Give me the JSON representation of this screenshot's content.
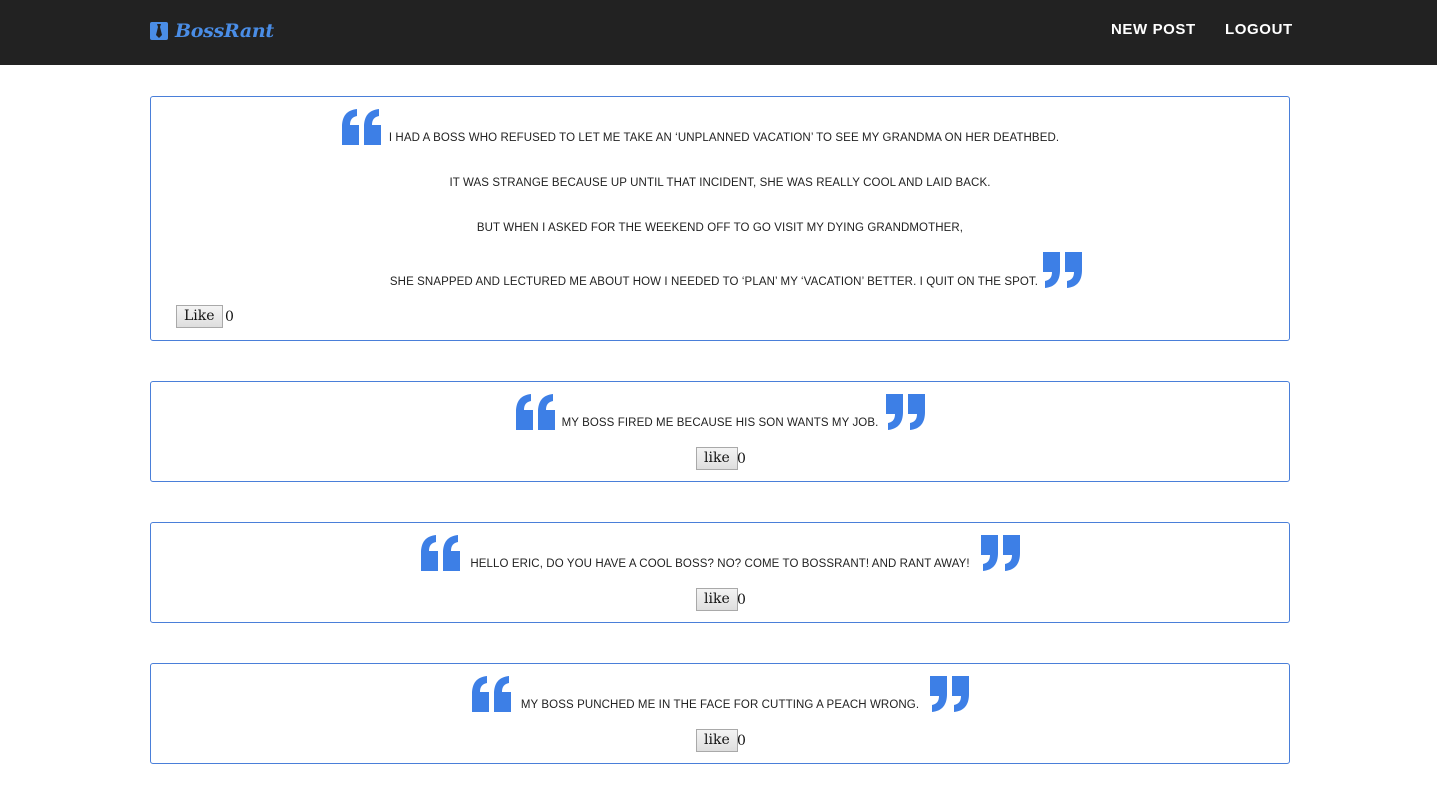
{
  "nav": {
    "brand": "BossRant",
    "new_post": "NEW POST",
    "logout": "LOGOUT"
  },
  "posts": [
    {
      "lines": [
        "I HAD A BOSS WHO REFUSED TO LET ME TAKE AN ‘UNPLANNED VACATION’ TO SEE MY GRANDMA ON HER DEATHBED.",
        "IT WAS STRANGE BECAUSE UP UNTIL THAT INCIDENT, SHE WAS REALLY COOL AND LAID BACK.",
        "BUT WHEN I ASKED FOR THE WEEKEND OFF TO GO VISIT MY DYING GRANDMOTHER,",
        "SHE SNAPPED AND LECTURED ME ABOUT HOW I NEEDED TO ‘PLAN’ MY ‘VACATION’ BETTER. I QUIT ON THE SPOT."
      ],
      "like_label": "Like",
      "likes": "0"
    },
    {
      "text": "MY BOSS FIRED ME BECAUSE HIS SON WANTS MY JOB.",
      "like_label": "like",
      "likes": "0"
    },
    {
      "text": "HELLO ERIC, DO YOU HAVE A COOL BOSS? NO? COME TO BOSSRANT! AND RANT AWAY!",
      "like_label": "like",
      "likes": "0"
    },
    {
      "text": "MY BOSS PUNCHED ME IN THE FACE FOR CUTTING A PEACH WRONG.",
      "like_label": "like",
      "likes": "0"
    }
  ],
  "colors": {
    "navbar": "#222222",
    "accent": "#4a8de6",
    "card_border": "#4a7fd9",
    "quote": "#3d7fe6"
  },
  "icons": {
    "brand": "necktie-icon",
    "open_quote": "open-quote-icon",
    "close_quote": "close-quote-icon"
  }
}
